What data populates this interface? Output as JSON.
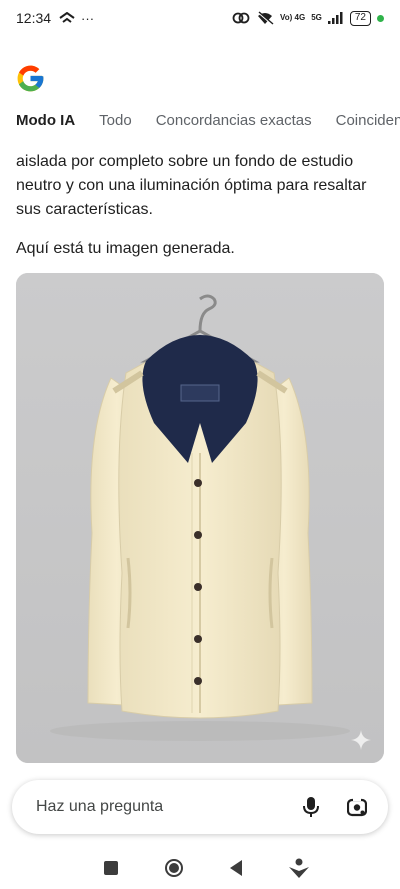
{
  "status_bar": {
    "time": "12:34",
    "left_icons": [
      "wifi-calling-icon",
      "more-dots-icon"
    ],
    "network_label": "Vo) 4G",
    "network_label_2": "5G",
    "battery": "72"
  },
  "tabs": [
    {
      "label": "Modo IA",
      "active": true
    },
    {
      "label": "Todo",
      "active": false
    },
    {
      "label": "Concordancias exactas",
      "active": false
    },
    {
      "label": "Coincidencias",
      "active": false
    }
  ],
  "content": {
    "paragraph1": "aislada por completo sobre un fondo de estudio neutro y con una iluminación óptima para resaltar sus características.",
    "paragraph2": "Aquí está tu imagen generada."
  },
  "ask_bar": {
    "placeholder": "Haz una pregunta",
    "icons": [
      "microphone-icon",
      "google-lens-icon"
    ]
  },
  "nav_bar": {
    "icons": [
      "recent-apps-icon",
      "home-icon",
      "back-icon",
      "assistant-icon"
    ]
  },
  "colors": {
    "card_background": "#c8c8c9",
    "jacket_body": "#f1e6c4",
    "jacket_collar": "#1f2a4a",
    "accent_green": "#2fb34a"
  }
}
